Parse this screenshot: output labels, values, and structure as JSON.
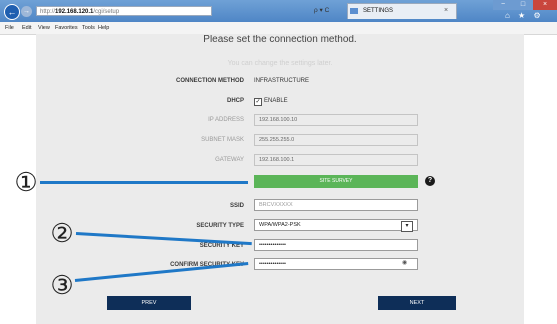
{
  "browser": {
    "address_prefix": "http://",
    "address_host": "192.168.120.1",
    "address_suffix": "/cgi/setup",
    "search_controls": "ρ ▾ C",
    "tab_title": "SETTINGS",
    "tab_close": "×",
    "window_min": "−",
    "window_max": "□",
    "window_close": "×",
    "right_icons": "⌂ ★ ⚙",
    "back_glyph": "←",
    "forward_glyph": "→",
    "menu": [
      "File",
      "Edit",
      "View",
      "Favorites",
      "Tools",
      "Help"
    ]
  },
  "page": {
    "heading": "Please set the connection method.",
    "subheading": "You can change the settings later.",
    "connection_method": {
      "label": "CONNECTION METHOD",
      "value": "INFRASTRUCTURE"
    },
    "dhcp": {
      "label": "DHCP",
      "checkbox_mark": "✓",
      "option": "ENABLE",
      "checked": true
    },
    "ip_address": {
      "label": "IP ADDRESS",
      "value": "192.168.100.10"
    },
    "subnet_mask": {
      "label": "SUBNET MASK",
      "value": "255.255.255.0"
    },
    "gateway": {
      "label": "GATEWAY",
      "value": "192.168.100.1"
    },
    "site_survey": {
      "label": "SITE SURVEY",
      "help_icon": "?"
    },
    "ssid": {
      "label": "SSID",
      "value": "BRCVXXXXX"
    },
    "security_type": {
      "label": "SECURITY TYPE",
      "value": "WPA/WPA2-PSK",
      "arrow": "▾"
    },
    "security_key": {
      "label": "SECURITY KEY",
      "value": "••••••••••••••"
    },
    "confirm_security_key": {
      "label": "CONFIRM SECURITY KEY",
      "value": "••••••••••••••",
      "eye_icon": "◉"
    },
    "prev_button": "PREV",
    "next_button": "NEXT"
  },
  "annotations": {
    "marker_1": "①",
    "marker_2": "②",
    "marker_3": "③"
  },
  "colors": {
    "survey_button": "#5bb558",
    "nav_button": "#0e2e58",
    "pointer_line": "#1f78c7",
    "titlebar": "#4f86c6"
  }
}
